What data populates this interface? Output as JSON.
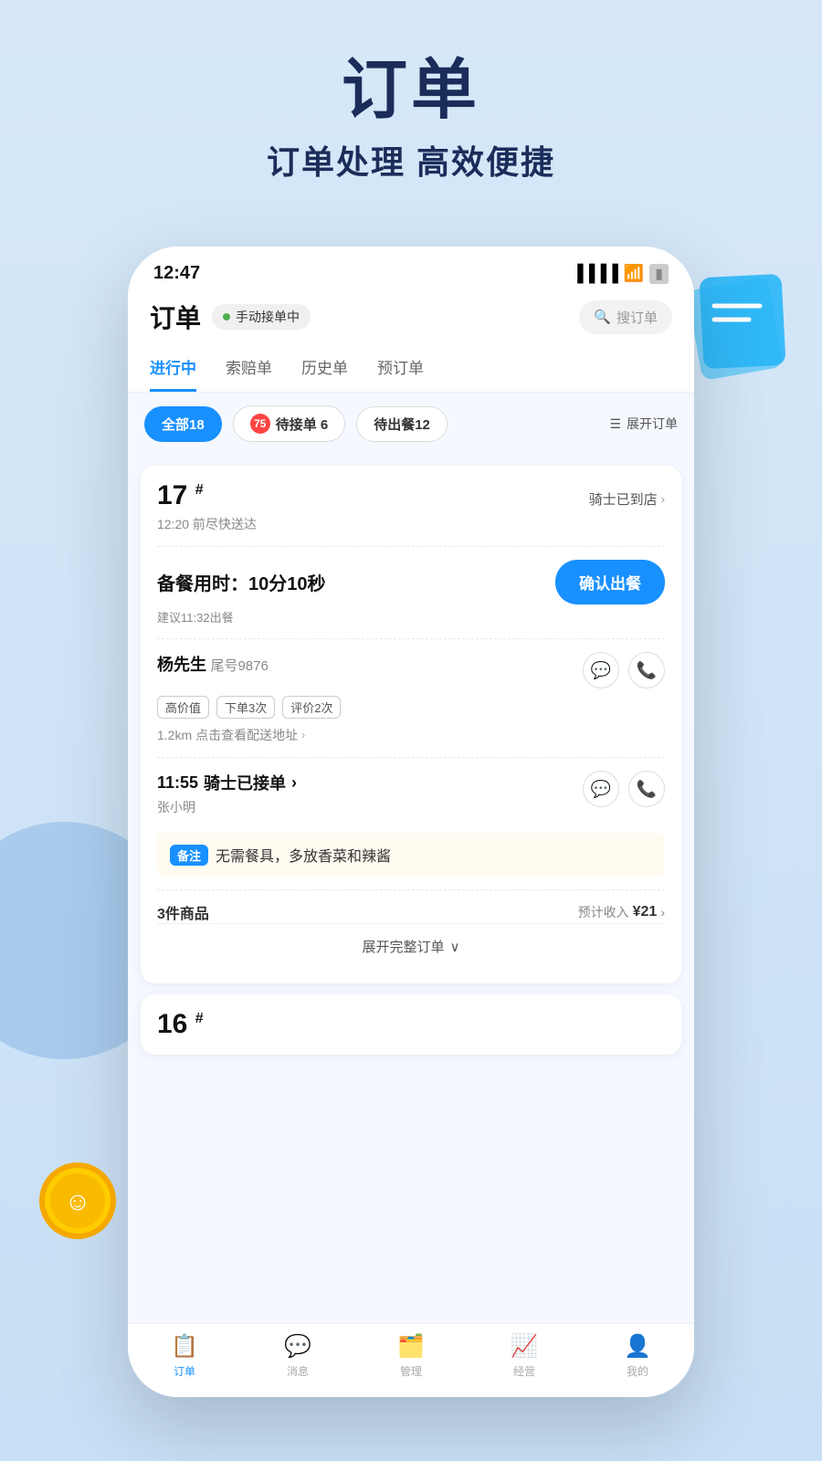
{
  "hero": {
    "title": "订单",
    "subtitle": "订单处理 高效便捷"
  },
  "phone": {
    "statusBar": {
      "time": "12:47"
    },
    "header": {
      "title": "订单",
      "statusBadge": "手动接单中",
      "searchPlaceholder": "搜订单"
    },
    "tabs": [
      {
        "label": "进行中",
        "active": true
      },
      {
        "label": "索赔单",
        "active": false
      },
      {
        "label": "历史单",
        "active": false
      },
      {
        "label": "预订单",
        "active": false
      }
    ],
    "filters": [
      {
        "label": "全部18",
        "active": true
      },
      {
        "label": "待接单 6",
        "badge": "75",
        "hasBadge": true,
        "active": false
      },
      {
        "label": "待出餐12",
        "active": false
      }
    ],
    "expandOrdersLabel": "展开订单",
    "order1": {
      "number": "17",
      "riderStatus": "骑士已到店",
      "timeNote": "12:20 前尽快送达",
      "prepareLabel": "备餐用时：10分10秒",
      "confirmLabel": "确认出餐",
      "suggestTime": "建议11:32出餐",
      "customerName": "杨先生",
      "customerId": "尾号9876",
      "tags": [
        "高价值",
        "下单3次",
        "评价2次"
      ],
      "distance": "1.2km",
      "addressLink": "点击查看配送地址",
      "riderTime": "11:55",
      "riderStatusText": "骑士已接单",
      "riderName": "张小明",
      "remark": "无需餐具，多放香菜和辣酱",
      "itemsCount": "3件商品",
      "incomeLabel": "预计收入",
      "incomeAmount": "¥21",
      "expandLabel": "展开完整订单"
    },
    "order2": {
      "number": "16"
    },
    "nav": [
      {
        "label": "订单",
        "active": true
      },
      {
        "label": "消息",
        "active": false
      },
      {
        "label": "管理",
        "active": false
      },
      {
        "label": "经营",
        "active": false
      },
      {
        "label": "我的",
        "active": false
      }
    ]
  }
}
